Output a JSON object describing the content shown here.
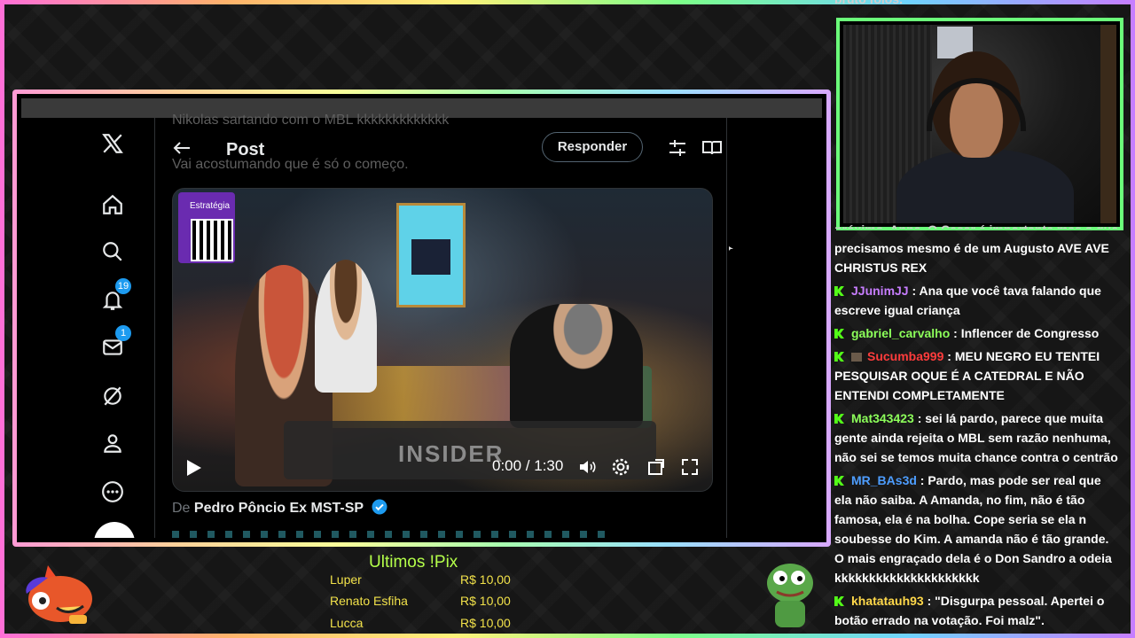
{
  "chat_top_cut": "bruto folos.",
  "chat_mid_cut": "próximo, Anna. O Cesar é importante mas o que",
  "chat": [
    {
      "user": "",
      "message": "precisamos mesmo é de um Augusto AVE AVE CHRISTUS REX",
      "color": ""
    },
    {
      "user": "JJunimJJ",
      "message": " : Ana que você tava falando que escreve igual criança",
      "color": "purple"
    },
    {
      "user": "gabriel_carvalho",
      "message": " : Inflencer de Congresso",
      "color": "green"
    },
    {
      "user": "Sucumba999",
      "message": " : MEU NEGRO EU TENTEI PESQUISAR OQUE É A CATEDRAL E NÃO ENTENDI COMPLETAMENTE",
      "color": "red"
    },
    {
      "user": "Mat343423",
      "message": " : sei lá pardo, parece que muita gente ainda rejeita o MBL sem razão nenhuma, não sei se temos muita chance contra o centrão",
      "color": "green"
    },
    {
      "user": "MR_BAs3d",
      "message": " : Pardo, mas pode ser real que ela não saiba. A Amanda, no fim, não é tão famosa, ela é na bolha. Cope seria se ela n soubesse do Kim. A amanda não é tão grande. O mais engraçado dela é o Don Sandro a odeia kkkkkkkkkkkkkkkkkkkkk",
      "color": "blue"
    },
    {
      "user": "khatatauh93",
      "message": " : \"Disgurpa pessoal. Apertei o botão errado na votação. Foi malz\".",
      "color": "yellow"
    }
  ],
  "x": {
    "ghost_text_1": "Nikolas sartando com o MBL kkkkkkkkkkkkk",
    "ghost_text_2": "Vai acostumando que é só o começo.",
    "header_title": "Post",
    "reply_label": "Responder",
    "notifications_badge": "19",
    "messages_badge": "1",
    "video_time": "0:00 / 1:30",
    "video_overlay": "INSIDER",
    "video_logo": "Estratégia",
    "author_prefix": "De",
    "author_name": "Pedro Pôncio Ex MST-SP"
  },
  "pix": {
    "title": "Ultimos !Pix",
    "rows": [
      {
        "name": "Luper",
        "value": "R$ 10,00"
      },
      {
        "name": "Renato Esfiha",
        "value": "R$ 10,00"
      },
      {
        "name": "Lucca",
        "value": "R$ 10,00"
      }
    ]
  },
  "colors": {
    "kick_green": "#53fc18",
    "x_blue": "#1d9bf0",
    "webcam_border": "#6bff7a",
    "pix_text": "#f2e24a"
  }
}
